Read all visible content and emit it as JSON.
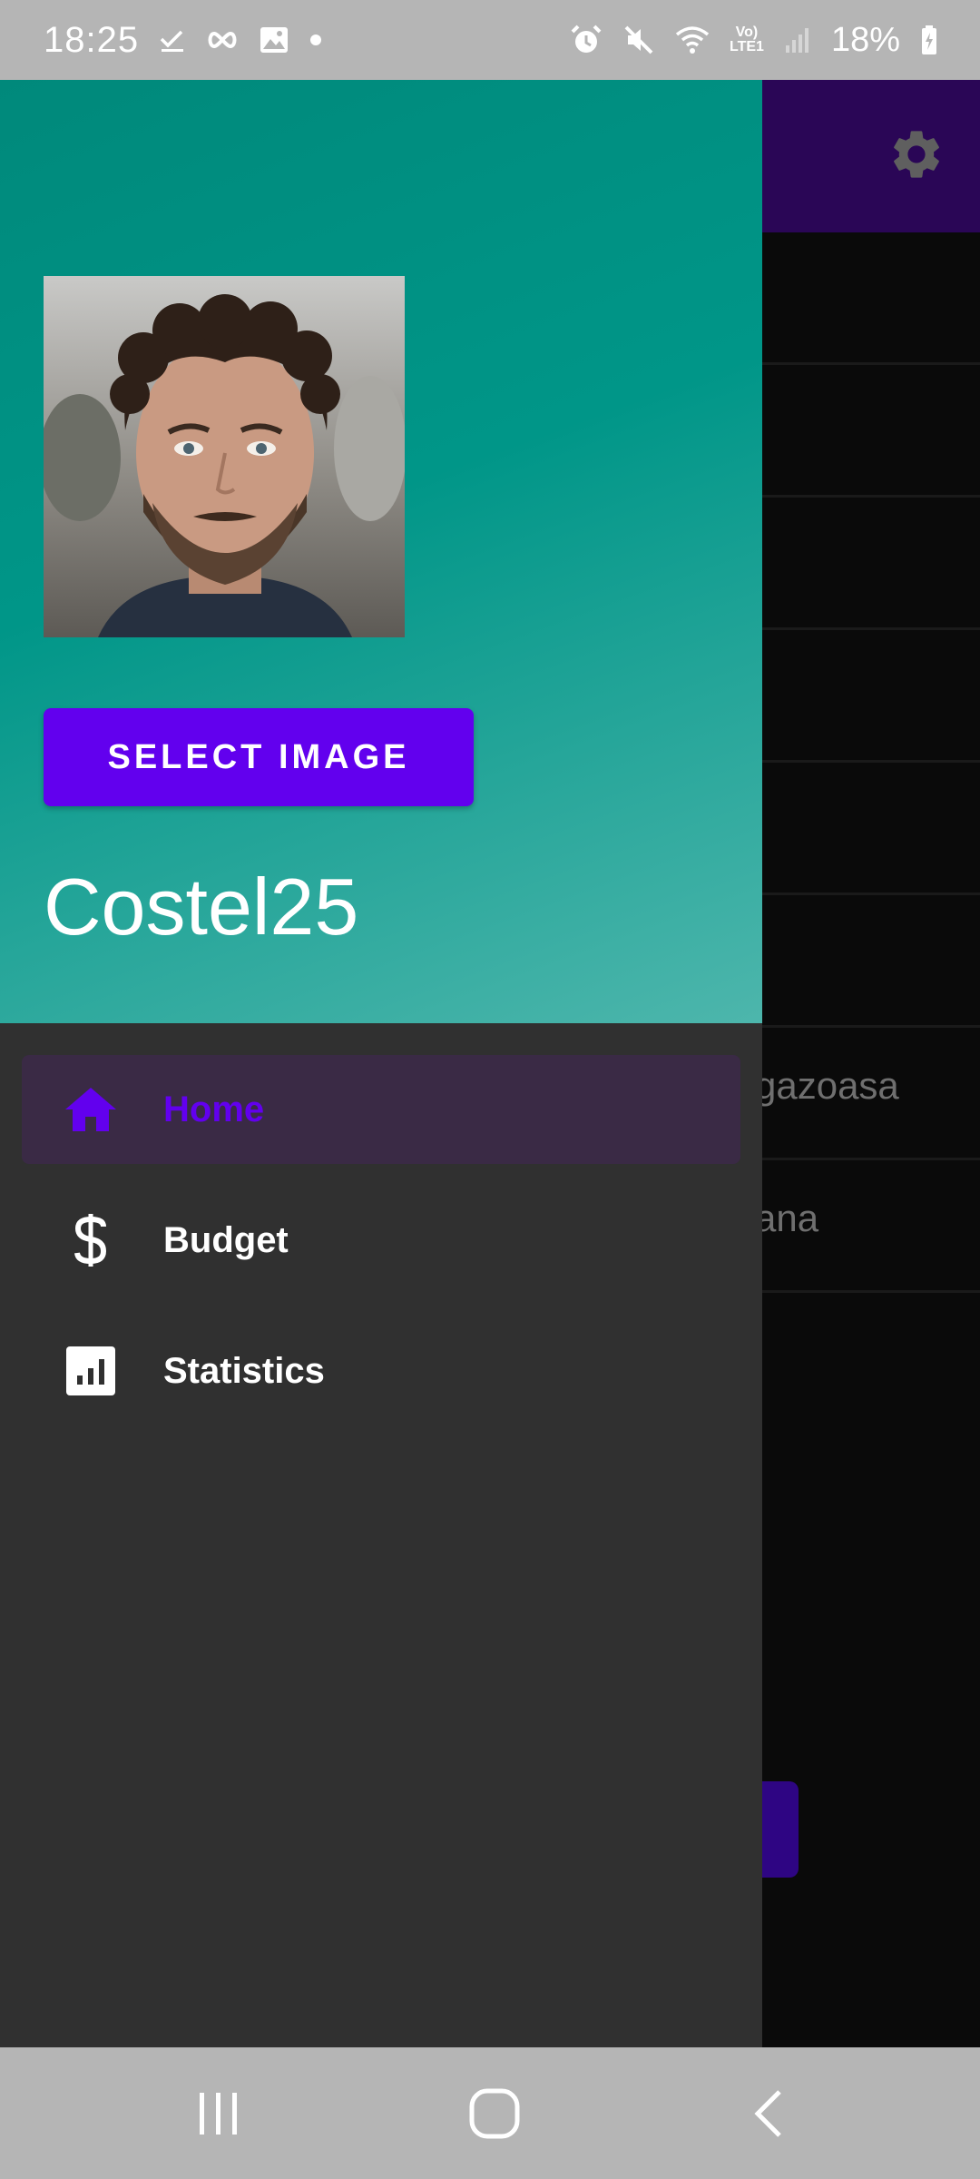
{
  "status_bar": {
    "time": "18:25",
    "icons_left": [
      "check-download-icon",
      "infinity-icon",
      "gallery-icon",
      "dot-icon"
    ],
    "icons_right": [
      "alarm-icon",
      "mute-icon",
      "wifi-icon",
      "volte-lte-icon",
      "signal-icon",
      "battery-icon"
    ],
    "volte_top": "Vo)",
    "volte_bottom": "LTE1",
    "battery": "18%"
  },
  "drawer": {
    "header": {
      "select_image_label": "SELECT IMAGE",
      "username": "Costel25"
    },
    "items": [
      {
        "label": "Home",
        "icon": "home-icon",
        "active": true
      },
      {
        "label": "Budget",
        "icon": "dollar-icon",
        "active": false
      },
      {
        "label": "Statistics",
        "icon": "statistics-icon",
        "active": false
      }
    ]
  },
  "background_app": {
    "settings_icon": "gear-icon",
    "row_fragments": [
      "gazoasa",
      "ana"
    ]
  },
  "navigation_bar": {
    "buttons": [
      "recent-apps-icon",
      "home-circle-icon",
      "back-icon"
    ]
  },
  "colors": {
    "accent": "#6200ee",
    "drawer_header": "#009688",
    "drawer_bg": "#303030",
    "toolbar": "#2a0656"
  }
}
